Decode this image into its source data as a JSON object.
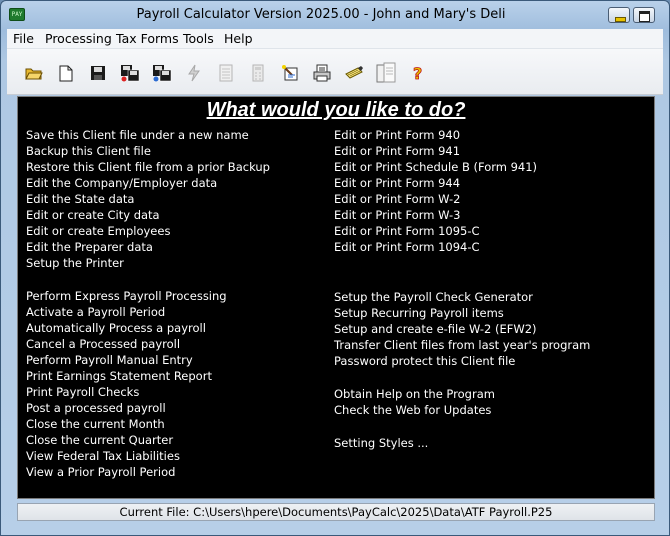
{
  "window": {
    "title": "Payroll Calculator Version 2025.00 - John and Mary's Deli",
    "icon_text": "PAY",
    "icon": "app-payroll-icon"
  },
  "menu": {
    "items": [
      "File",
      "Processing",
      "Tax Forms",
      "Tools",
      "Help"
    ]
  },
  "toolbar": {
    "buttons": [
      {
        "icon": "open-folder-icon"
      },
      {
        "icon": "new-document-icon"
      },
      {
        "icon": "save-disk-icon"
      },
      {
        "icon": "backup-disk-icon"
      },
      {
        "icon": "restore-disk-icon"
      },
      {
        "icon": "express-payroll-icon",
        "enabled": false
      },
      {
        "icon": "report-grid-icon",
        "enabled": false
      },
      {
        "icon": "calculator-icon",
        "enabled": false
      },
      {
        "icon": "magic-check-icon"
      },
      {
        "icon": "print-report-icon"
      },
      {
        "icon": "check-writer-icon"
      },
      {
        "icon": "forms-icon"
      },
      {
        "icon": "help-question-icon"
      }
    ]
  },
  "main": {
    "heading": "What would you like to do?",
    "left_group1": [
      "Save this Client file under a new name",
      "Backup this Client file",
      "Restore this Client file from a prior Backup",
      "Edit the Company/Employer data",
      "Edit the State data",
      "Edit or create City data",
      "Edit or create Employees",
      "Edit the Preparer data",
      "Setup the Printer"
    ],
    "left_group2": [
      "Perform Express Payroll Processing",
      "Activate a Payroll Period",
      "Automatically Process a payroll",
      "Cancel a Processed payroll",
      "Perform Payroll Manual Entry",
      "Print Earnings Statement Report",
      "Print Payroll Checks",
      "Post a processed payroll",
      "Close the current Month",
      "Close the current Quarter",
      "View Federal Tax Liabilities",
      "View a Prior Payroll Period"
    ],
    "right_group1": [
      "Edit or Print Form 940",
      "Edit or Print Form 941",
      "Edit or Print Schedule B (Form 941)",
      "Edit or Print Form 944",
      "Edit or Print Form W-2",
      "Edit or Print Form W-3",
      "Edit or Print Form 1095-C",
      "Edit or Print Form 1094-C"
    ],
    "right_group2": [
      "Setup the Payroll Check Generator",
      "Setup Recurring Payroll items",
      "Setup and create e-file W-2 (EFW2)",
      "Transfer Client files from last year's program",
      "Password protect this Client file"
    ],
    "right_group3": [
      "Obtain Help on the Program",
      "Check the Web for Updates"
    ],
    "right_group4": [
      "Setting Styles ..."
    ]
  },
  "status": {
    "current_file": "Current File: C:\\Users\\hpere\\Documents\\PayCalc\\2025\\Data\\ATF Payroll.P25"
  }
}
